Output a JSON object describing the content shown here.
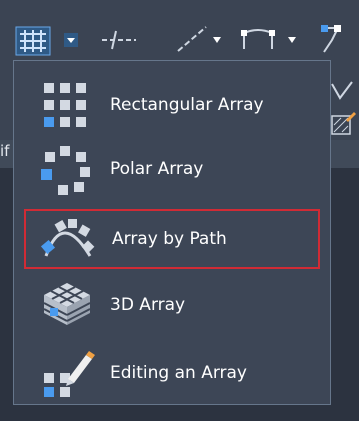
{
  "cut_text": "if",
  "toolbar": {
    "icons": [
      "array-grid-icon",
      "dropdown-arrow-icon",
      "trim-icon",
      "line-icon",
      "dropdown-arrow-icon",
      "polyline-icon",
      "dropdown-arrow-icon",
      "bracket-icon"
    ]
  },
  "menu": {
    "items": [
      {
        "label": "Rectangular Array",
        "icon": "rectangular-array-icon"
      },
      {
        "label": "Polar Array",
        "icon": "polar-array-icon"
      },
      {
        "label": "Array by Path",
        "icon": "path-array-icon",
        "selected": true
      },
      {
        "label": "3D Array",
        "icon": "3d-array-icon"
      },
      {
        "label": "Editing an Array",
        "icon": "edit-array-icon"
      }
    ]
  },
  "colors": {
    "accent": "#4a9bef",
    "selection_border": "#d12b35",
    "menu_bg": "#3d4656"
  }
}
